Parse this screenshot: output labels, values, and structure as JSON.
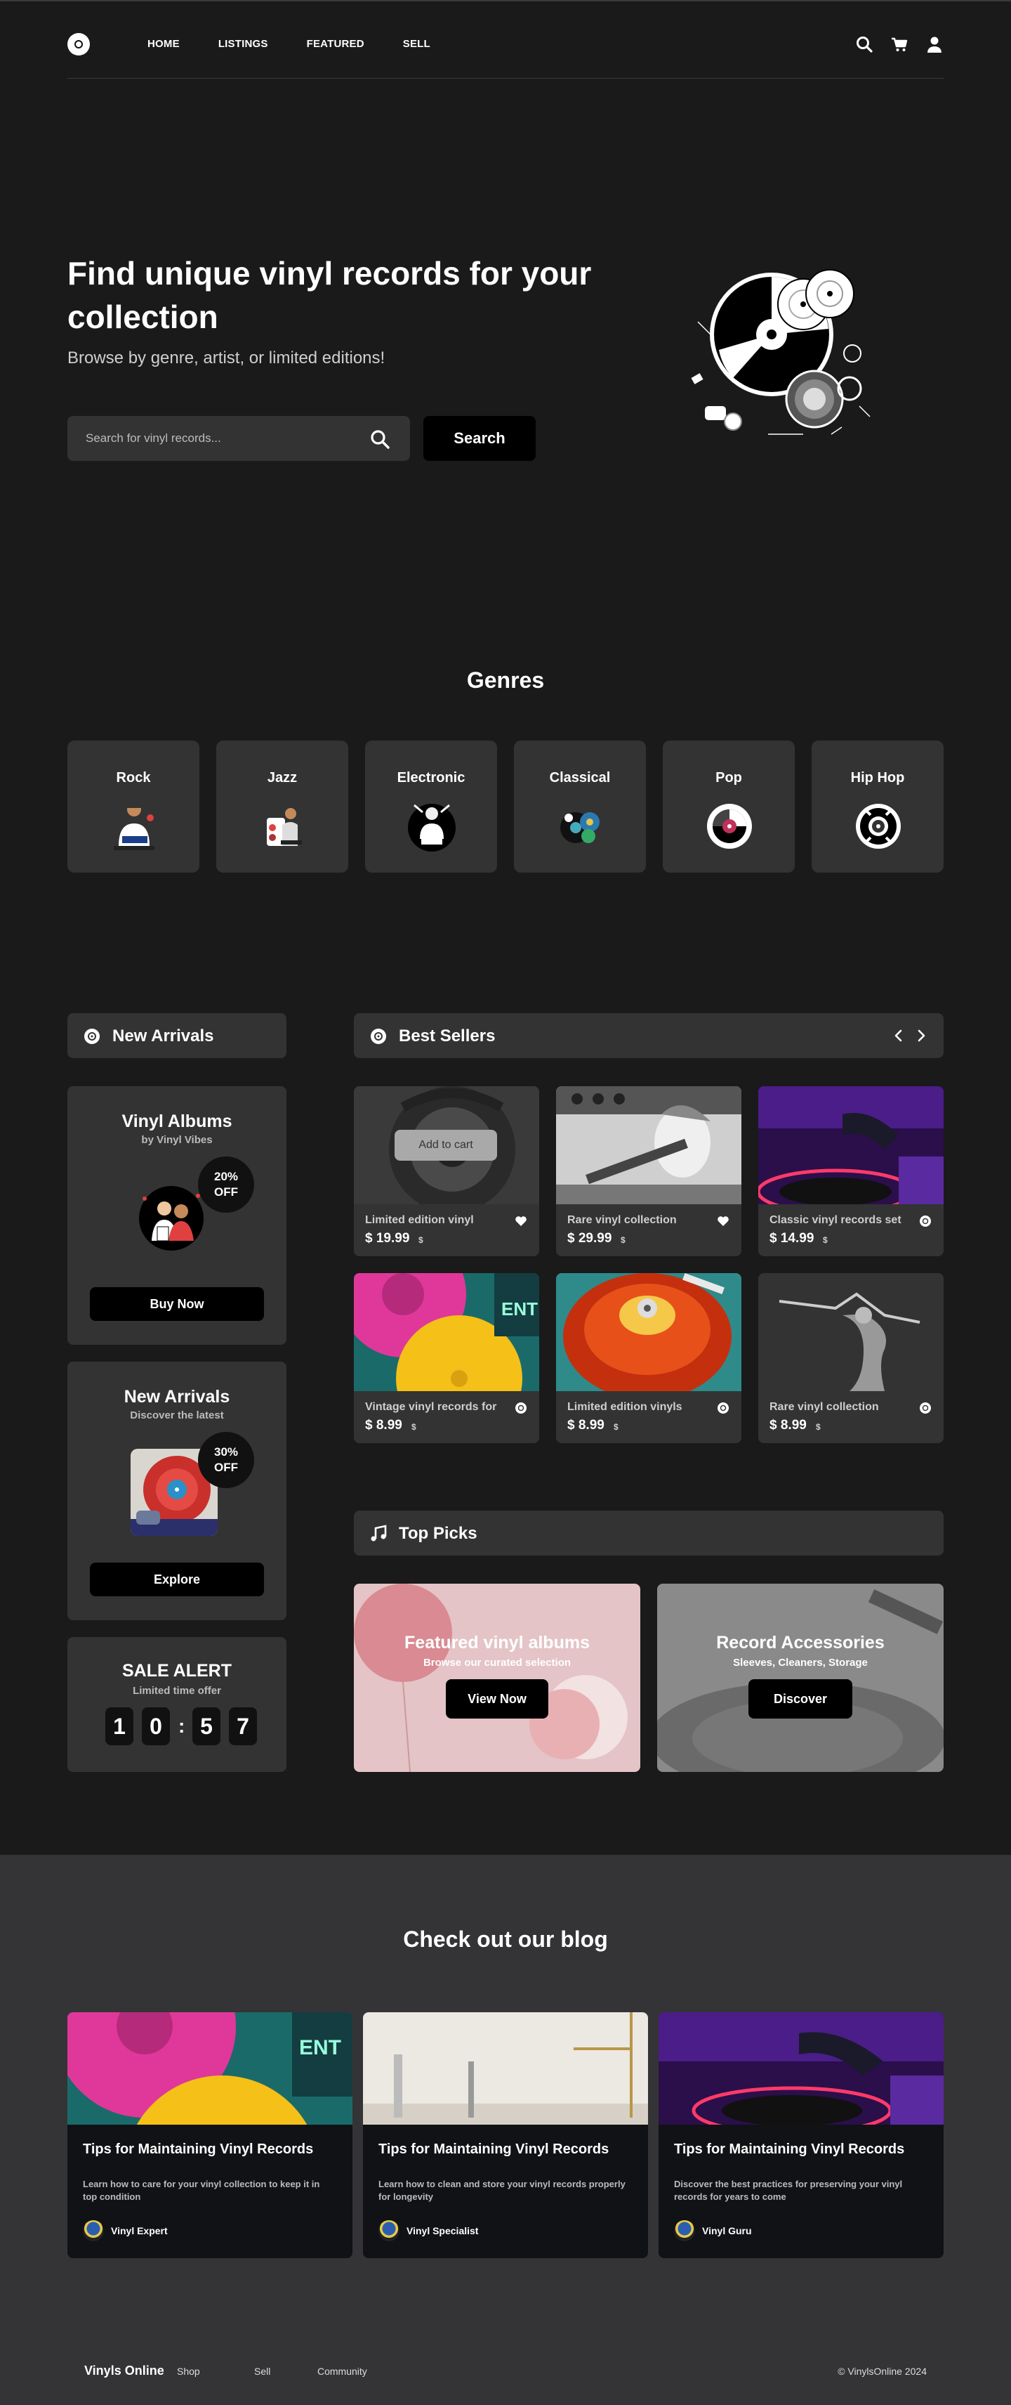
{
  "nav": {
    "links": [
      "HOME",
      "LISTINGS",
      "FEATURED",
      "SELL"
    ],
    "icons": [
      "search-icon",
      "cart-icon",
      "user-icon"
    ]
  },
  "hero": {
    "title": "Find unique vinyl records for your collection",
    "subtitle": "Browse by genre, artist, or limited editions!",
    "search_placeholder": "Search for vinyl records...",
    "search_button": "Search"
  },
  "genres": {
    "title": "Genres",
    "items": [
      "Rock",
      "Jazz",
      "Electronic",
      "Classical",
      "Pop",
      "Hip Hop"
    ]
  },
  "sidebar": {
    "new_arrivals_header": "New Arrivals",
    "promo1": {
      "title": "Vinyl Albums",
      "subtitle": "by Vinyl Vibes",
      "badge_pct": "20%",
      "badge_off": "OFF",
      "button": "Buy Now"
    },
    "promo2": {
      "title": "New Arrivals",
      "subtitle": "Discover the latest",
      "badge_pct": "30%",
      "badge_off": "OFF",
      "button": "Explore"
    },
    "sale": {
      "title": "SALE ALERT",
      "subtitle": "Limited time offer",
      "digits": [
        "1",
        "0",
        "5",
        "7"
      ],
      "separator": ":"
    }
  },
  "best_sellers": {
    "header": "Best Sellers",
    "add_to_cart": "Add to cart",
    "products": [
      {
        "name": "Limited edition vinyl",
        "price": "$ 19.99",
        "currency": "$",
        "action_icon": "heart-icon"
      },
      {
        "name": "Rare vinyl collection",
        "price": "$ 29.99",
        "currency": "$",
        "action_icon": "heart-icon"
      },
      {
        "name": "Classic vinyl records set",
        "price": "$ 14.99",
        "currency": "$",
        "action_icon": "disc-icon"
      },
      {
        "name": "Vintage vinyl records for",
        "price": "$ 8.99",
        "currency": "$",
        "action_icon": "disc-icon"
      },
      {
        "name": "Limited edition vinyls",
        "price": "$ 8.99",
        "currency": "$",
        "action_icon": "disc-icon"
      },
      {
        "name": "Rare vinyl collection",
        "price": "$ 8.99",
        "currency": "$",
        "action_icon": "disc-icon"
      }
    ]
  },
  "top_picks": {
    "header": "Top Picks",
    "cards": [
      {
        "title": "Featured vinyl albums",
        "subtitle": "Browse our curated selection",
        "button": "View Now"
      },
      {
        "title": "Record Accessories",
        "subtitle": "Sleeves, Cleaners, Storage",
        "button": "Discover"
      }
    ]
  },
  "blog": {
    "title": "Check out our blog",
    "posts": [
      {
        "title": "Tips for Maintaining Vinyl Records",
        "desc": "Learn how to care for your vinyl collection to keep it in top condition",
        "author": "Vinyl Expert"
      },
      {
        "title": "Tips for Maintaining Vinyl Records",
        "desc": "Learn how to clean and store your vinyl records properly for longevity",
        "author": "Vinyl Specialist"
      },
      {
        "title": "Tips for Maintaining Vinyl Records",
        "desc": "Discover the best practices for preserving your vinyl records for years to come",
        "author": "Vinyl Guru"
      }
    ]
  },
  "footer": {
    "brand": "Vinyls Online",
    "links": [
      "Shop",
      "Sell",
      "Community"
    ],
    "copyright": "© VinylsOnline 2024"
  }
}
